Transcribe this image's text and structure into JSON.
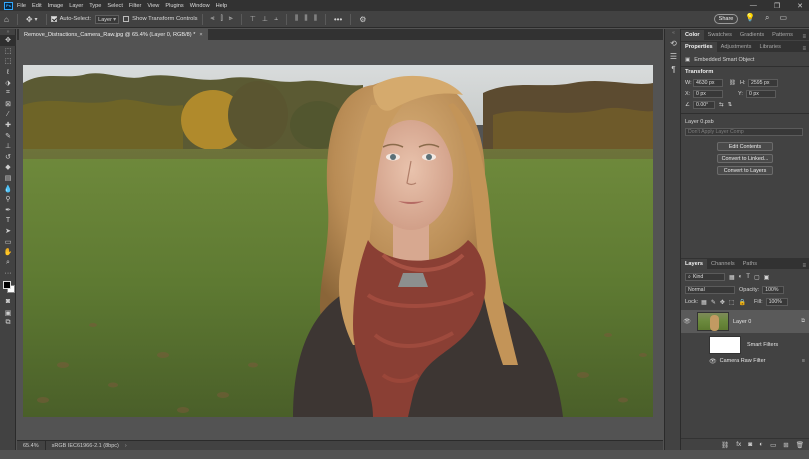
{
  "app": {
    "logo": "Ps"
  },
  "menu": [
    "File",
    "Edit",
    "Image",
    "Layer",
    "Type",
    "Select",
    "Filter",
    "View",
    "Plugins",
    "Window",
    "Help"
  ],
  "options_bar": {
    "auto_select_label": "Auto-Select:",
    "auto_select_checked": true,
    "auto_select_value": "Layer",
    "show_transform_label": "Show Transform Controls",
    "show_transform_checked": false,
    "share_label": "Share"
  },
  "document": {
    "tab_title": "Remove_Distractions_Camera_Raw.jpg @ 65.4% (Layer 0, RGB/8) *",
    "zoom": "65.4%",
    "color_profile": "sRGB IEC61966-2.1 (8bpc)"
  },
  "panels": {
    "top_tabs": [
      "Color",
      "Swatches",
      "Gradients",
      "Patterns"
    ],
    "mid_tabs": [
      "Properties",
      "Adjustments",
      "Libraries"
    ],
    "properties": {
      "object_type": "Embedded Smart Object",
      "transform_heading": "Transform",
      "w_label": "W:",
      "w_value": "4630 px",
      "h_label": "H:",
      "h_value": "2595 px",
      "x_label": "X:",
      "x_value": "0 px",
      "y_label": "Y:",
      "y_value": "0 px",
      "angle_value": "0.00°",
      "linked_file": "Layer 0.psb",
      "layer_comp_placeholder": "Don't Apply Layer Comp",
      "edit_contents": "Edit Contents",
      "convert_linked": "Convert to Linked...",
      "convert_layers": "Convert to Layers"
    },
    "layers_tabs": [
      "Layers",
      "Channels",
      "Paths"
    ],
    "layers": {
      "filter_kind": "Kind",
      "blend_mode": "Normal",
      "opacity_label": "Opacity:",
      "opacity_value": "100%",
      "lock_label": "Lock:",
      "fill_label": "Fill:",
      "fill_value": "100%",
      "layer_name": "Layer 0",
      "smart_filters": "Smart Filters",
      "filter_name": "Camera Raw Filter"
    }
  }
}
